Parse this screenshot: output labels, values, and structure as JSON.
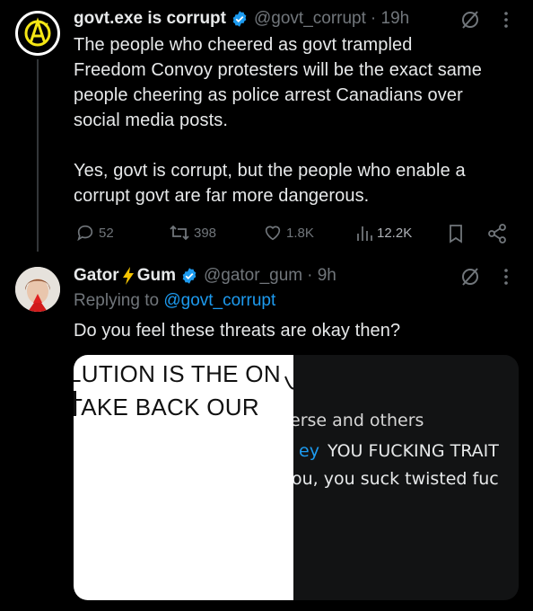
{
  "tweet1": {
    "name": "govt.exe is corrupt",
    "handle": "@govt_corrupt",
    "time": "· 19h",
    "lines": [
      "The people who cheered as govt trampled",
      "Freedom Convoy protesters will be the exact same",
      "people cheering as police arrest Canadians over",
      "social media posts.",
      "",
      "Yes, govt is corrupt, but the people who enable a",
      "corrupt govt are far more dangerous."
    ],
    "metrics": {
      "replies": "52",
      "retweets": "398",
      "likes": "1.8K",
      "views": "12.2K"
    }
  },
  "tweet2": {
    "name": "Gator",
    "name_suffix": "Gum",
    "handle": "@gator_gum",
    "time": "· 9h",
    "replying_prefix": "Replying to",
    "replying_to": "@govt_corrupt",
    "text": "Do you feel these threats are okay then?",
    "media_left_lines": [
      "LUTION IS THE ON",
      "TAKE BACK OUR"
    ],
    "media_right_lines": [
      "erse and others",
      "ey",
      "YOU FUCKING TRAIT",
      "ou, you suck twisted fuc"
    ]
  },
  "colors": {
    "background": "#000000",
    "text": "#e7e9ea",
    "muted": "#71767b",
    "accent": "#1d9bf0",
    "verified": "#1d9bf0"
  },
  "icons": [
    "anarchy-avatar-icon",
    "verified-badge-icon",
    "grok-icon",
    "more-icon",
    "reply-icon",
    "retweet-icon",
    "like-icon",
    "views-icon",
    "bookmark-icon",
    "share-icon",
    "lightning-icon"
  ]
}
